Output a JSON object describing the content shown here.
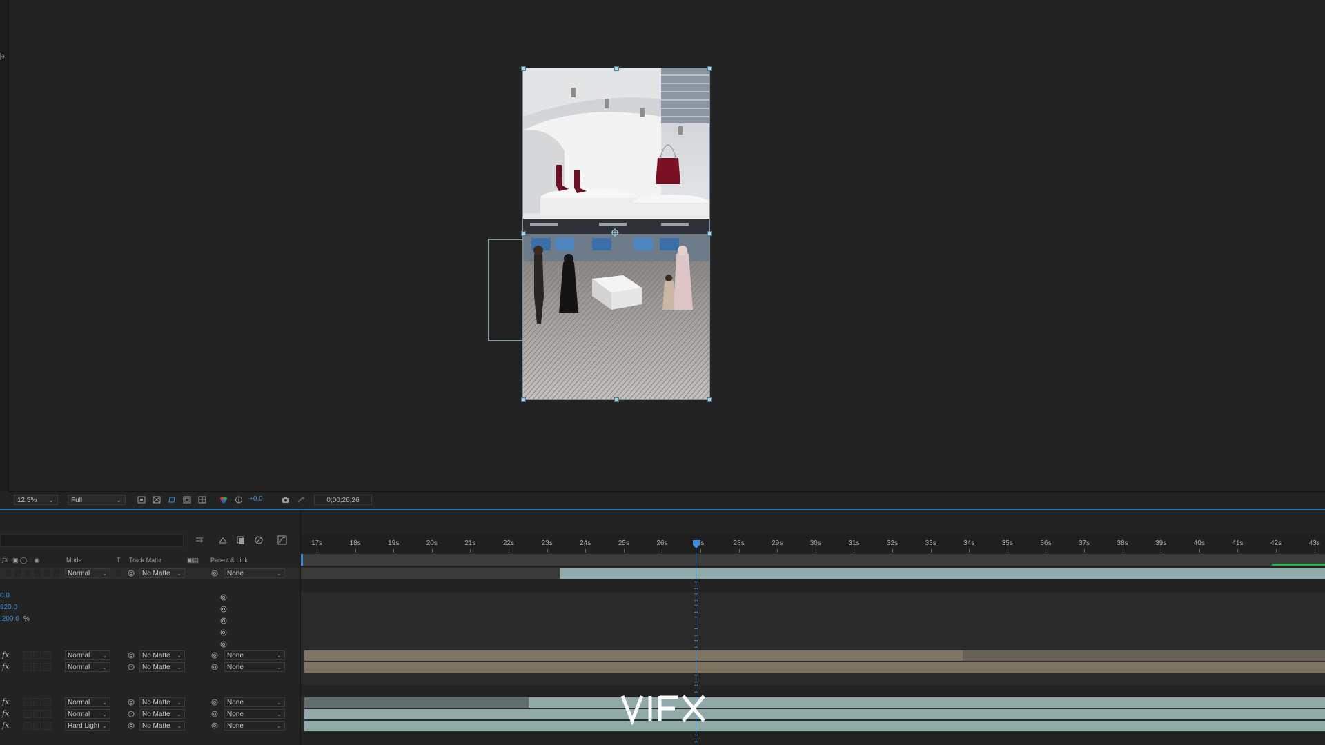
{
  "viewer": {
    "zoom": "12.5%",
    "resolution": "Full",
    "exposure": "+0.0",
    "timecode": "0;00;26;26"
  },
  "timeline": {
    "columns": {
      "mode": "Mode",
      "t": "T",
      "track_matte": "Track Matte",
      "parent_link": "Parent & Link"
    },
    "ruler_labels": [
      "17s",
      "18s",
      "19s",
      "20s",
      "21s",
      "22s",
      "23s",
      "24s",
      "25s",
      "26s",
      "27s",
      "28s",
      "29s",
      "30s",
      "31s",
      "32s",
      "33s",
      "34s",
      "35s",
      "36s",
      "37s",
      "38s",
      "39s",
      "40s",
      "41s",
      "42s",
      "43s"
    ],
    "playhead_label_visible": "7s",
    "layers": [
      {
        "fx": "",
        "mode": "Normal",
        "matte": "No Matte",
        "parent": "None"
      },
      {
        "fx": "fx",
        "mode": "Normal",
        "matte": "No Matte",
        "parent": "None"
      },
      {
        "fx": "fx",
        "mode": "Normal",
        "matte": "No Matte",
        "parent": "None"
      },
      {
        "fx": "fx",
        "mode": "Normal",
        "matte": "No Matte",
        "parent": "None"
      },
      {
        "fx": "fx",
        "mode": "Normal",
        "matte": "No Matte",
        "parent": "None"
      },
      {
        "fx": "fx",
        "mode": "Hard Light",
        "matte": "No Matte",
        "parent": "None"
      }
    ],
    "properties": {
      "p1": "0.0",
      "p2": "920.0",
      "p3": ",200.0",
      "p3_unit": "%"
    }
  },
  "watermark": "VIFX",
  "colors": {
    "accent": "#3d8ee0",
    "teal_bar": "#8fa9a6",
    "tan_bar": "#7d735f",
    "green_marker": "#27b34a"
  }
}
